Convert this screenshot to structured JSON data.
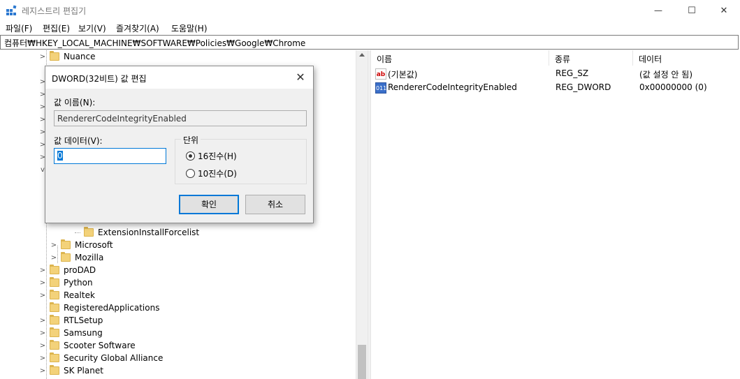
{
  "window": {
    "title": "레지스트리 편집기",
    "minimize": "—",
    "maximize": "☐",
    "close": "✕"
  },
  "menu": [
    "파일(F)",
    "편집(E)",
    "보기(V)",
    "즐겨찾기(A)",
    "도움말(H)"
  ],
  "address": "컴퓨터₩HKEY_LOCAL_MACHINE₩SOFTWARE₩Policies₩Google₩Chrome",
  "tree": {
    "items": [
      {
        "label": "Nuance"
      },
      {
        "label": "ExtensionInstallForcelist"
      },
      {
        "label": "Microsoft"
      },
      {
        "label": "Mozilla"
      },
      {
        "label": "proDAD"
      },
      {
        "label": "Python"
      },
      {
        "label": "Realtek"
      },
      {
        "label": "RegisteredApplications"
      },
      {
        "label": "RTLSetup"
      },
      {
        "label": "Samsung"
      },
      {
        "label": "Scooter Software"
      },
      {
        "label": "Security Global Alliance"
      },
      {
        "label": "SK Planet"
      }
    ]
  },
  "list": {
    "headers": {
      "name": "이름",
      "type": "종류",
      "data": "데이터"
    },
    "rows": [
      {
        "icon": "ab",
        "name": "(기본값)",
        "type": "REG_SZ",
        "data": "(값 설정 안 됨)"
      },
      {
        "icon": "011",
        "name": "RendererCodeIntegrityEnabled",
        "type": "REG_DWORD",
        "data": "0x00000000 (0)"
      }
    ]
  },
  "dialog": {
    "title": "DWORD(32비트) 값 편집",
    "close": "✕",
    "name_label": "값 이름(N):",
    "name_value": "RendererCodeIntegrityEnabled",
    "data_label": "값 데이터(V):",
    "data_value": "0",
    "unit_label": "단위",
    "hex_label": "16진수(H)",
    "dec_label": "10진수(D)",
    "ok_label": "확인",
    "cancel_label": "취소"
  }
}
